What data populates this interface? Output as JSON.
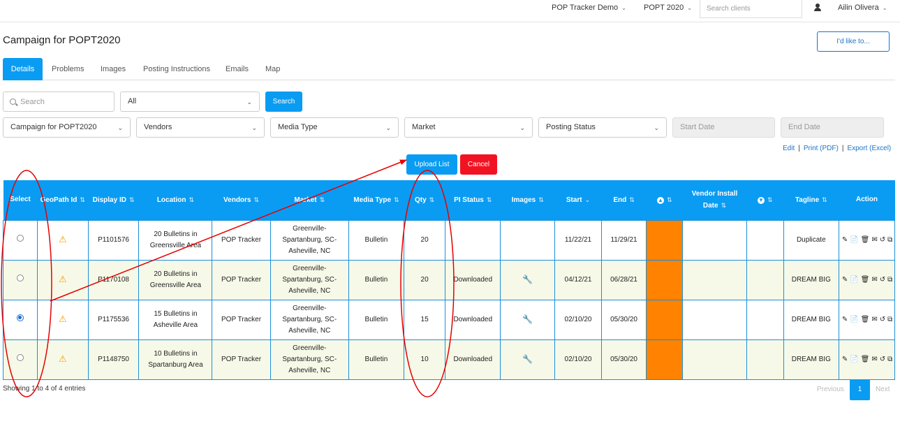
{
  "topbar": {
    "demo_label": "POP Tracker Demo",
    "campaign_label": "POPT 2020",
    "client_search_placeholder": "Search clients",
    "user_name": "Ailin Olivera"
  },
  "page": {
    "title": "Campaign for POPT2020",
    "like_button": "I'd like to..."
  },
  "tabs": [
    "Details",
    "Problems",
    "Images",
    "Posting Instructions",
    "Emails",
    "Map"
  ],
  "filters": {
    "search_placeholder": "Search",
    "status_select": "All",
    "search_button": "Search",
    "campaign_select": "Campaign for POPT2020",
    "vendors_select": "Vendors",
    "media_type_select": "Media Type",
    "market_select": "Market",
    "posting_status_select": "Posting Status",
    "start_date_placeholder": "Start Date",
    "end_date_placeholder": "End Date"
  },
  "links": {
    "edit": "Edit",
    "print": "Print (PDF)",
    "export": "Export (Excel)",
    "separator": "|"
  },
  "buttons": {
    "upload": "Upload List",
    "cancel": "Cancel"
  },
  "table": {
    "headers": {
      "select": "Select",
      "geopath": "GeoPath Id",
      "display": "Display ID",
      "location": "Location",
      "vendors": "Vendors",
      "market": "Market",
      "media": "Media Type",
      "qty": "Qty",
      "pi": "PI Status",
      "images": "Images",
      "start": "Start",
      "end": "End",
      "install": "Vendor Install Date",
      "tagline": "Tagline",
      "action": "Action"
    },
    "rows": [
      {
        "display": "P1101576",
        "location": "20 Bulletins in Greensville Area",
        "vendor": "POP Tracker",
        "market": "Greenville-Spartanburg, SC-Asheville, NC",
        "media": "Bulletin",
        "qty": "20",
        "pi": "",
        "start": "11/22/21",
        "end": "11/29/21",
        "tagline": "Duplicate"
      },
      {
        "display": "P1170108",
        "location": "20 Bulletins in Greensville Area",
        "vendor": "POP Tracker",
        "market": "Greenville-Spartanburg, SC-Asheville, NC",
        "media": "Bulletin",
        "qty": "20",
        "pi": "Downloaded",
        "start": "04/12/21",
        "end": "06/28/21",
        "tagline": "DREAM BIG"
      },
      {
        "display": "P1175536",
        "location": "15 Bulletins in Asheville Area",
        "vendor": "POP Tracker",
        "market": "Greenville-Spartanburg, SC-Asheville, NC",
        "media": "Bulletin",
        "qty": "15",
        "pi": "Downloaded",
        "start": "02/10/20",
        "end": "05/30/20",
        "tagline": "DREAM BIG"
      },
      {
        "display": "P1148750",
        "location": "10 Bulletins in Spartanburg Area",
        "vendor": "POP Tracker",
        "market": "Greenville-Spartanburg, SC-Asheville, NC",
        "media": "Bulletin",
        "qty": "10",
        "pi": "Downloaded",
        "start": "02/10/20",
        "end": "05/30/20",
        "tagline": "DREAM BIG"
      }
    ],
    "selected_row": 2
  },
  "footer": {
    "info": "Showing 1 to 4 of 4 entries",
    "previous": "Previous",
    "page": "1",
    "next": "Next"
  },
  "colors": {
    "accent": "#0a9cf2",
    "cancel": "#f21322",
    "status_cell": "#ff8200",
    "annotation": "#e60000"
  },
  "icons": [
    "user-icon",
    "search-icon",
    "warning-icon",
    "wrench-icon",
    "edit-icon",
    "document-icon",
    "trash-icon",
    "email-icon",
    "history-icon",
    "copy-icon"
  ]
}
